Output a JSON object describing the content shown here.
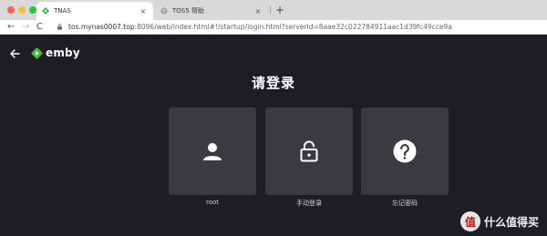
{
  "browser": {
    "tabs": [
      {
        "title": "TNAS",
        "close": "×",
        "active": true,
        "favicon": "tnas-green-diamond-icon"
      },
      {
        "title": "TOS5 帮助",
        "close": "×",
        "active": false,
        "favicon": "tos-help-icon"
      }
    ],
    "new_tab": "+",
    "nav": {
      "back": "←",
      "forward": "→",
      "reload": "C"
    },
    "url_host": "tos.mynas0007.top",
    "url_rest": ":8096/web/index.html#!/startup/login.html?serverId=8aae32c022784911aac1d39fc49cce9a"
  },
  "app": {
    "brand": "emby",
    "brand_color": "#52b54b",
    "heading": "请登录",
    "users": [
      {
        "label": "root",
        "icon": "user-icon"
      },
      {
        "label": "手动登录",
        "icon": "unlock-icon"
      },
      {
        "label": "忘记密码",
        "icon": "question-icon"
      }
    ]
  },
  "watermark": {
    "badge": "值",
    "text": "什么值得买"
  }
}
